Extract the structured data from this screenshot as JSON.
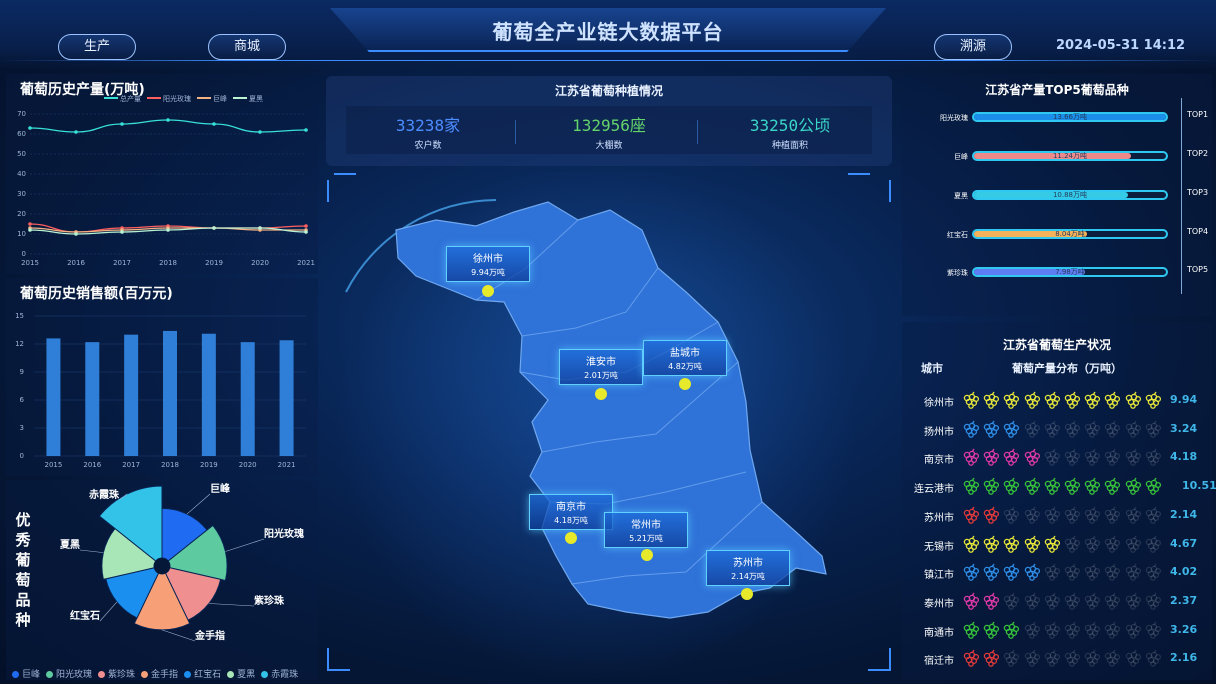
{
  "header": {
    "title": "葡萄全产业链大数据平台",
    "nav_left": [
      "生产",
      "商城"
    ],
    "nav_right": "溯源",
    "datetime": "2024-05-31 14:12"
  },
  "history_output": {
    "title": "葡萄历史产量(万吨)",
    "legend": [
      "总产量",
      "阳光玫瑰",
      "巨峰",
      "夏黑"
    ],
    "colors": [
      "#38e0d8",
      "#ff5f5f",
      "#f4b183",
      "#b9f3d4"
    ],
    "y_ticks": [
      "70",
      "60",
      "50",
      "40",
      "30",
      "20",
      "10",
      "0"
    ],
    "x_ticks": [
      "2015",
      "2016",
      "2017",
      "2018",
      "2019",
      "2020",
      "2021"
    ]
  },
  "history_sales": {
    "title": "葡萄历史销售额(百万元)",
    "y_ticks": [
      "15",
      "12",
      "9",
      "6",
      "3",
      "0"
    ],
    "x_ticks": [
      "2015",
      "2016",
      "2017",
      "2018",
      "2019",
      "2020",
      "2021"
    ]
  },
  "varieties": {
    "title": "优秀葡萄品种",
    "labels": [
      "巨峰",
      "阳光玫瑰",
      "紫珍珠",
      "金手指",
      "红宝石",
      "夏黑",
      "赤霞珠"
    ],
    "legend": [
      "巨峰",
      "阳光玫瑰",
      "紫珍珠",
      "金手指",
      "红宝石",
      "夏黑",
      "赤霞珠"
    ],
    "colors": [
      "#1f6cf2",
      "#5dcaa0",
      "#ef8f8f",
      "#f7a078",
      "#1b8ff0",
      "#a8e6b8",
      "#33c3e8"
    ]
  },
  "planting": {
    "title": "江苏省葡萄种植情况",
    "stats": [
      {
        "value": "33238家",
        "label": "农户数",
        "color": "#4d8dff"
      },
      {
        "value": "132956座",
        "label": "大棚数",
        "color": "#63d36a"
      },
      {
        "value": "33250公顷",
        "label": "种植面积",
        "color": "#39d6c8"
      }
    ]
  },
  "map": {
    "cities": [
      {
        "name": "徐州市",
        "amount": "9.94万吨"
      },
      {
        "name": "淮安市",
        "amount": "2.01万吨"
      },
      {
        "name": "盐城市",
        "amount": "4.82万吨"
      },
      {
        "name": "南京市",
        "amount": "4.18万吨"
      },
      {
        "name": "常州市",
        "amount": "5.21万吨"
      },
      {
        "name": "苏州市",
        "amount": "2.14万吨"
      }
    ]
  },
  "top5": {
    "title": "江苏省产量TOP5葡萄品种",
    "rows": [
      {
        "name": "阳光玫瑰",
        "value": "13.66万吨",
        "rank": "TOP1",
        "color": "#1a8ee8"
      },
      {
        "name": "巨峰",
        "value": "11.24万吨",
        "rank": "TOP2",
        "color": "#ef8a8a"
      },
      {
        "name": "夏黑",
        "value": "10.88万吨",
        "rank": "TOP3",
        "color": "#35cbe6"
      },
      {
        "name": "红宝石",
        "value": "8.04万吨",
        "rank": "TOP4",
        "color": "#f4b35a"
      },
      {
        "name": "紫珍珠",
        "value": "7.98万吨",
        "rank": "TOP5",
        "color": "#5f7df2"
      }
    ]
  },
  "production": {
    "title": "江苏省葡萄生产状况",
    "col_city": "城市",
    "col_dist": "葡萄产量分布（万吨）",
    "rows": [
      {
        "city": "徐州市",
        "value": "9.94",
        "filled": 10,
        "color": "#e8e83a"
      },
      {
        "city": "扬州市",
        "value": "3.24",
        "filled": 3,
        "color": "#2f8ee8"
      },
      {
        "city": "南京市",
        "value": "4.18",
        "filled": 4,
        "color": "#e03aa8"
      },
      {
        "city": "连云港市",
        "value": "10.51",
        "filled": 10,
        "color": "#36c23a"
      },
      {
        "city": "苏州市",
        "value": "2.14",
        "filled": 2,
        "color": "#e23a3a"
      },
      {
        "city": "无锡市",
        "value": "4.67",
        "filled": 5,
        "color": "#e8e83a"
      },
      {
        "city": "镇江市",
        "value": "4.02",
        "filled": 4,
        "color": "#2f8ee8"
      },
      {
        "city": "泰州市",
        "value": "2.37",
        "filled": 2,
        "color": "#e03aa8"
      },
      {
        "city": "南通市",
        "value": "3.26",
        "filled": 3,
        "color": "#36c23a"
      },
      {
        "city": "宿迁市",
        "value": "2.16",
        "filled": 2,
        "color": "#e23a3a"
      }
    ]
  },
  "chart_data": [
    {
      "type": "line",
      "title": "葡萄历史产量(万吨)",
      "x": [
        "2015",
        "2016",
        "2017",
        "2018",
        "2019",
        "2020",
        "2021"
      ],
      "ylim": [
        0,
        70
      ],
      "series": [
        {
          "name": "总产量",
          "values": [
            63,
            61,
            65,
            67,
            65,
            61,
            62
          ]
        },
        {
          "name": "阳光玫瑰",
          "values": [
            15,
            11,
            13,
            14,
            13,
            13,
            14
          ]
        },
        {
          "name": "巨峰",
          "values": [
            13,
            11,
            12,
            13,
            13,
            12,
            12
          ]
        },
        {
          "name": "夏黑",
          "values": [
            12,
            10,
            11,
            12,
            13,
            13,
            11
          ]
        }
      ]
    },
    {
      "type": "bar",
      "title": "葡萄历史销售额(百万元)",
      "categories": [
        "2015",
        "2016",
        "2017",
        "2018",
        "2019",
        "2020",
        "2021"
      ],
      "values": [
        12.6,
        12.2,
        13.0,
        13.4,
        13.1,
        12.2,
        12.4
      ],
      "ylim": [
        0,
        15
      ]
    },
    {
      "type": "pie",
      "title": "优秀葡萄品种",
      "categories": [
        "巨峰",
        "阳光玫瑰",
        "紫珍珠",
        "金手指",
        "红宝石",
        "夏黑",
        "赤霞珠"
      ],
      "values": [
        40,
        46,
        42,
        45,
        40,
        42,
        58
      ]
    }
  ]
}
